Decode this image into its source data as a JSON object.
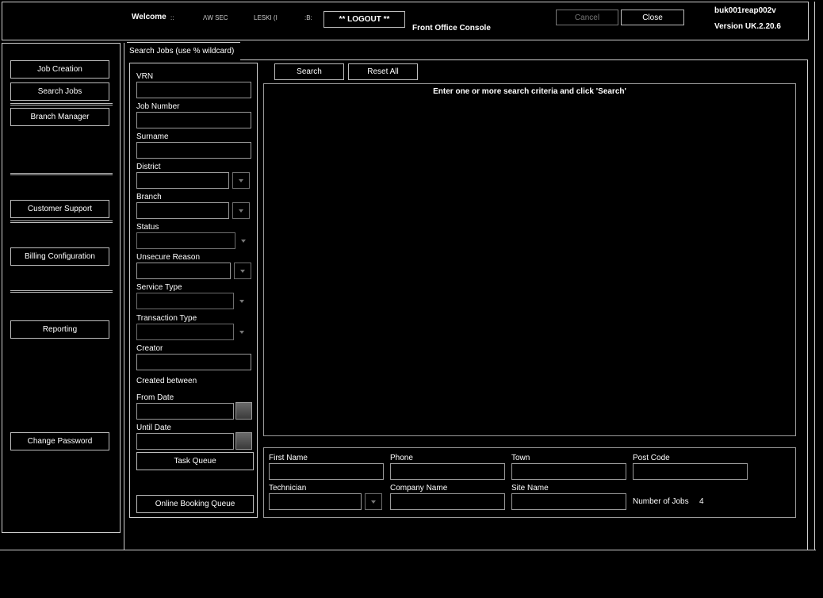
{
  "header": {
    "welcome": "Welcome",
    "user_fragments": [
      "::",
      "ΛW SEC",
      "LESKI (I",
      ":B:"
    ],
    "logout_label": "** LOGOUT **",
    "console_title": "Front Office Console",
    "cancel_label": "Cancel",
    "close_label": "Close",
    "host": "buk001reap002v",
    "version": "Version UK.2.20.6"
  },
  "sidebar": {
    "items": [
      {
        "label": "Job Creation"
      },
      {
        "label": "Search Jobs"
      },
      {
        "label": "Branch Manager"
      },
      {
        "label": "Customer Support"
      },
      {
        "label": "Billing Configuration"
      },
      {
        "label": "Reporting"
      },
      {
        "label": "Change Password"
      }
    ]
  },
  "search_panel": {
    "tab_label": "Search Jobs (use % wildcard)",
    "fields": {
      "vrn": {
        "label": "VRN",
        "value": ""
      },
      "job_number": {
        "label": "Job Number",
        "value": ""
      },
      "surname": {
        "label": "Surname",
        "value": ""
      },
      "district": {
        "label": "District",
        "value": ""
      },
      "branch": {
        "label": "Branch",
        "value": ""
      },
      "status": {
        "label": "Status",
        "value": ""
      },
      "unsecure_reason": {
        "label": "Unsecure Reason",
        "value": ""
      },
      "service_type": {
        "label": "Service Type",
        "value": ""
      },
      "transaction_type": {
        "label": "Transaction Type",
        "value": ""
      },
      "creator": {
        "label": "Creator",
        "value": ""
      },
      "created_between": {
        "label": "Created between"
      },
      "from_date": {
        "label": "From Date",
        "value": ""
      },
      "until_date": {
        "label": "Until Date",
        "value": ""
      }
    },
    "task_queue_label": "Task Queue",
    "online_booking_label": "Online Booking Queue"
  },
  "results": {
    "search_label": "Search",
    "reset_label": "Reset All",
    "message": "Enter one or more search criteria and click 'Search'"
  },
  "extra_filters": {
    "first_name": {
      "label": "First Name",
      "value": ""
    },
    "phone": {
      "label": "Phone",
      "value": ""
    },
    "town": {
      "label": "Town",
      "value": ""
    },
    "post_code": {
      "label": "Post Code",
      "value": ""
    },
    "technician": {
      "label": "Technician",
      "value": ""
    },
    "company_name": {
      "label": "Company Name",
      "value": ""
    },
    "site_name": {
      "label": "Site Name",
      "value": ""
    },
    "number_of_jobs_label": "Number of Jobs",
    "number_of_jobs": "4"
  }
}
